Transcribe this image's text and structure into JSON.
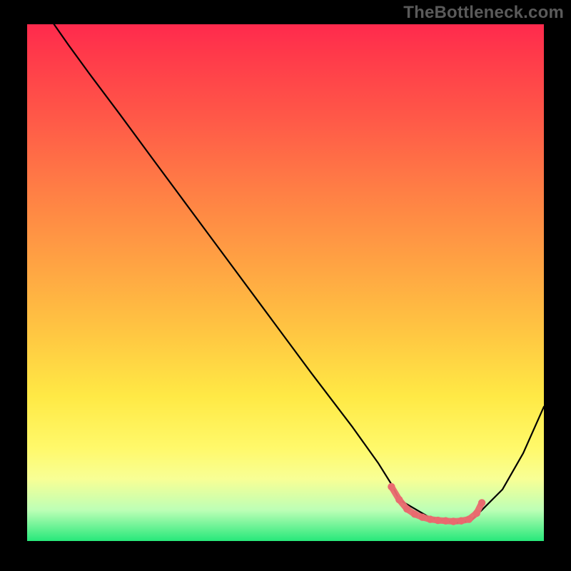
{
  "watermark": "TheBottleneck.com",
  "colors": {
    "page_bg": "#000000",
    "watermark": "#5a5a5a",
    "curve": "#000000",
    "marker": "#e96a6f",
    "gradient_top": "#ff2a4d",
    "gradient_bottom": "#27e87a"
  },
  "chart_data": {
    "type": "line",
    "title": "",
    "xlabel": "",
    "ylabel": "",
    "xlim": [
      0,
      100
    ],
    "ylim": [
      0,
      100
    ],
    "grid": false,
    "legend": false,
    "series": [
      {
        "name": "black-curve",
        "x": [
          5.2,
          8,
          12,
          18,
          25,
          35,
          45,
          55,
          63,
          68,
          70.5,
          72,
          78,
          83,
          86,
          92,
          96,
          100
        ],
        "y": [
          100,
          96,
          90.5,
          82.5,
          73,
          59.5,
          46,
          32.5,
          22,
          15,
          11,
          8,
          4.5,
          3.5,
          4,
          10,
          17,
          26
        ]
      },
      {
        "name": "marker-band",
        "x": [
          70.5,
          72,
          73.5,
          75,
          76.5,
          78,
          79.5,
          81,
          82.5,
          84,
          85.5,
          87,
          88
        ],
        "y": [
          10.5,
          8,
          6.2,
          5.2,
          4.6,
          4.2,
          4.0,
          3.9,
          3.8,
          3.9,
          4.2,
          5.4,
          7.4
        ]
      }
    ]
  }
}
